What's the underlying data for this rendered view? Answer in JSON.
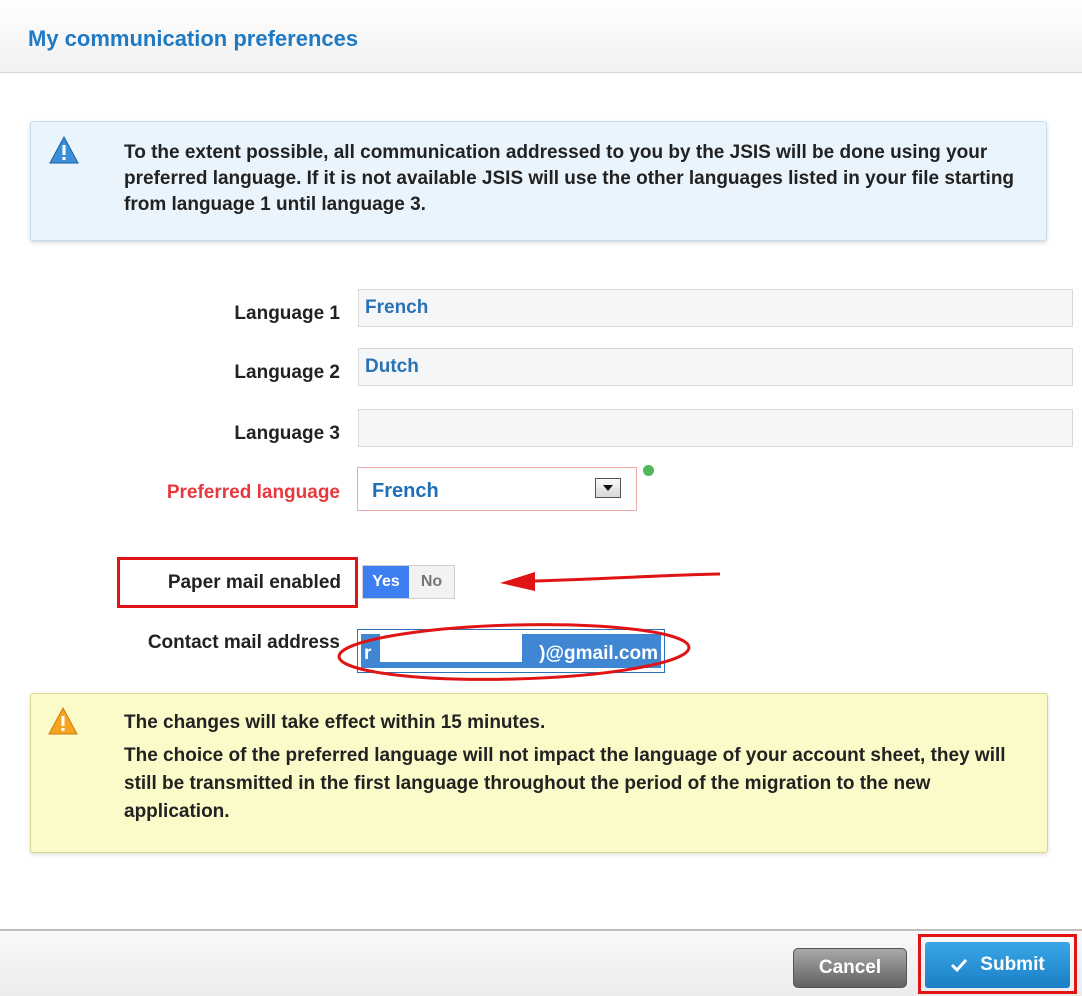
{
  "header": {
    "title": "My communication preferences"
  },
  "info": {
    "icon": "warning-triangle-blue-icon",
    "text": "To the extent possible, all communication addressed to you by the JSIS will be done using your preferred language. If it is not available JSIS will use the other languages listed in your file starting from language 1 until language 3."
  },
  "form": {
    "language1": {
      "label": "Language 1",
      "value": "French"
    },
    "language2": {
      "label": "Language 2",
      "value": "Dutch"
    },
    "language3": {
      "label": "Language 3",
      "value": ""
    },
    "preferred": {
      "label": "Preferred language",
      "value": "French"
    },
    "paper_mail": {
      "label": "Paper mail enabled",
      "yes": "Yes",
      "no": "No",
      "selected": "Yes"
    },
    "contact": {
      "label": "Contact mail address",
      "value_start": "r",
      "value_end": ")@gmail.com"
    }
  },
  "warning": {
    "icon": "warning-triangle-orange-icon",
    "line1": "The changes will take effect within 15 minutes.",
    "line2": "The choice of the preferred language will not impact the language of your account sheet, they will still be transmitted in the first language throughout the period of the migration to the new application."
  },
  "footer": {
    "cancel_label": "Cancel",
    "submit_label": "Submit"
  },
  "colors": {
    "accent": "#1f7ac4",
    "annotation_red": "#e01414",
    "toggle_on": "#3d7ef0"
  }
}
